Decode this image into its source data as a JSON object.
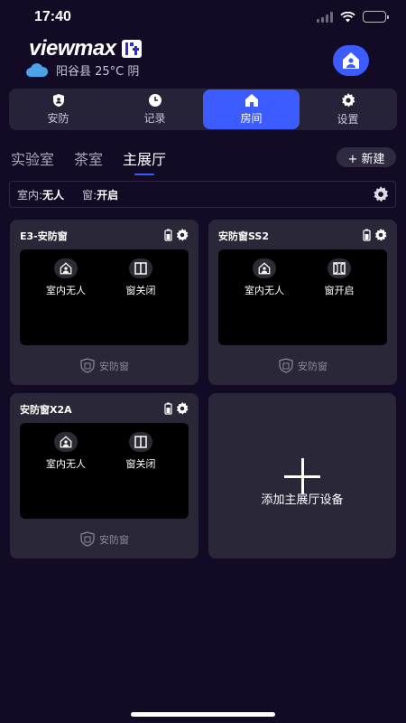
{
  "status_bar": {
    "time": "17:40"
  },
  "header": {
    "logo_text": "viewmax",
    "weather": "阳谷县 25°C 阴"
  },
  "tabs": [
    {
      "label": "安防",
      "icon": "shield-icon"
    },
    {
      "label": "记录",
      "icon": "clock-icon"
    },
    {
      "label": "房间",
      "icon": "home-icon",
      "active": true
    },
    {
      "label": "设置",
      "icon": "gear-icon"
    }
  ],
  "rooms": {
    "items": [
      "实验室",
      "茶室",
      "主展厅"
    ],
    "active": "主展厅",
    "new_label": "+ 新建"
  },
  "room_status": {
    "indoor_label": "室内:",
    "indoor_value": "无人",
    "window_label": "窗:",
    "window_value": "开启"
  },
  "devices": [
    {
      "name": "E3-安防窗",
      "presence": "室内无人",
      "window": "窗关闭",
      "type": "安防窗"
    },
    {
      "name": "安防窗SS2",
      "presence": "室内无人",
      "window": "窗开启",
      "type": "安防窗"
    },
    {
      "name": "安防窗X2A",
      "presence": "室内无人",
      "window": "窗关闭",
      "type": "安防窗"
    }
  ],
  "add_device": {
    "label": "添加主展厅设备"
  },
  "colors": {
    "background": "#130b26",
    "accent": "#3d5cff",
    "card": "#2a2738"
  }
}
